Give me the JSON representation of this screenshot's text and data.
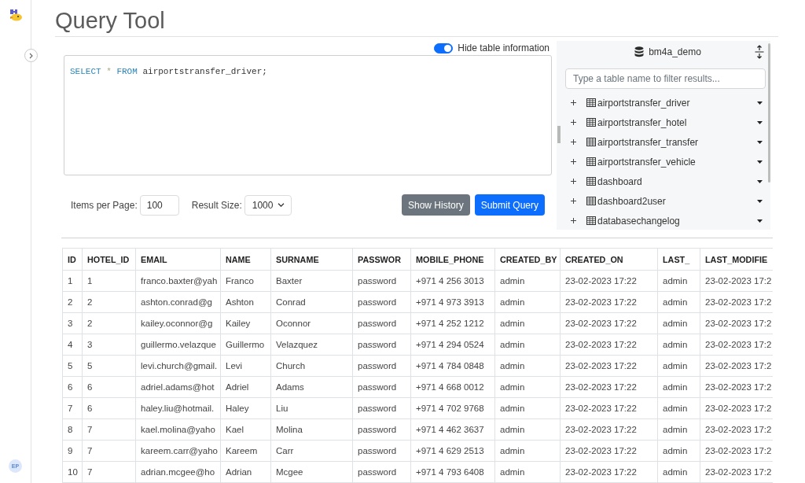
{
  "page": {
    "title": "Query Tool"
  },
  "sidebar": {
    "avatar": "EP"
  },
  "options": {
    "hide_table_info": {
      "label": "Hide table information",
      "on": true
    }
  },
  "editor": {
    "tokens": [
      {
        "kind": "keyword",
        "text": "SELECT"
      },
      {
        "kind": "operator",
        "text": "*"
      },
      {
        "kind": "keyword",
        "text": "FROM"
      },
      {
        "kind": "identifier",
        "text": "airportstransfer_driver;"
      }
    ]
  },
  "controls": {
    "items_per_page": {
      "label": "Items per Page:",
      "value": "100"
    },
    "result_size": {
      "label": "Result Size:",
      "value": "1000"
    },
    "buttons": [
      {
        "kind": "secondary",
        "label": "Show History"
      },
      {
        "kind": "primary",
        "label": "Submit Query"
      }
    ]
  },
  "table_panel": {
    "database": "bm4a_demo",
    "filter": {
      "placeholder": "Type a table name to filter results..."
    },
    "tables": [
      {
        "name": "airportstransfer_driver",
        "expanded": false
      },
      {
        "name": "airportstransfer_hotel",
        "expanded": false
      },
      {
        "name": "airportstransfer_transfer",
        "expanded": false
      },
      {
        "name": "airportstransfer_vehicle",
        "expanded": false
      },
      {
        "name": "dashboard",
        "expanded": false
      },
      {
        "name": "dashboard2user",
        "expanded": false
      },
      {
        "name": "databasechangelog",
        "expanded": false
      }
    ]
  },
  "results": {
    "columns": [
      "ID",
      "HOTEL_ID",
      "EMAIL",
      "NAME",
      "SURNAME",
      "PASSWOR",
      "MOBILE_PHONE",
      "CREATED_BY",
      "CREATED_ON",
      "LAST_",
      "LAST_MODIFIE"
    ],
    "rows": [
      [
        "1",
        "1",
        "franco.baxter@yah",
        "Franco",
        "Baxter",
        "password",
        "+971 4 256 3013",
        "admin",
        "23-02-2023 17:22",
        "admin",
        "23-02-2023 17:2"
      ],
      [
        "2",
        "2",
        "ashton.conrad@g",
        "Ashton",
        "Conrad",
        "password",
        "+971 4 973 3913",
        "admin",
        "23-02-2023 17:22",
        "admin",
        "23-02-2023 17:2"
      ],
      [
        "3",
        "2",
        "kailey.oconnor@g",
        "Kailey",
        "Oconnor",
        "password",
        "+971 4 252 1212",
        "admin",
        "23-02-2023 17:22",
        "admin",
        "23-02-2023 17:2"
      ],
      [
        "4",
        "3",
        "guillermo.velazque",
        "Guillermo",
        "Velazquez",
        "password",
        "+971 4 294 0524",
        "admin",
        "23-02-2023 17:22",
        "admin",
        "23-02-2023 17:2"
      ],
      [
        "5",
        "5",
        "levi.church@gmail.",
        "Levi",
        "Church",
        "password",
        "+971 4 784 0848",
        "admin",
        "23-02-2023 17:22",
        "admin",
        "23-02-2023 17:2"
      ],
      [
        "6",
        "6",
        "adriel.adams@hot",
        "Adriel",
        "Adams",
        "password",
        "+971 4 668 0012",
        "admin",
        "23-02-2023 17:22",
        "admin",
        "23-02-2023 17:2"
      ],
      [
        "7",
        "6",
        "haley.liu@hotmail.",
        "Haley",
        "Liu",
        "password",
        "+971 4 702 9768",
        "admin",
        "23-02-2023 17:22",
        "admin",
        "23-02-2023 17:2"
      ],
      [
        "8",
        "7",
        "kael.molina@yaho",
        "Kael",
        "Molina",
        "password",
        "+971 4 462 3637",
        "admin",
        "23-02-2023 17:22",
        "admin",
        "23-02-2023 17:2"
      ],
      [
        "9",
        "7",
        "kareem.carr@yaho",
        "Kareem",
        "Carr",
        "password",
        "+971 4 629 2513",
        "admin",
        "23-02-2023 17:22",
        "admin",
        "23-02-2023 17:2"
      ],
      [
        "10",
        "7",
        "adrian.mcgee@ho",
        "Adrian",
        "Mcgee",
        "password",
        "+971 4 793 6408",
        "admin",
        "23-02-2023 17:22",
        "admin",
        "23-02-2023 17:2"
      ]
    ]
  }
}
